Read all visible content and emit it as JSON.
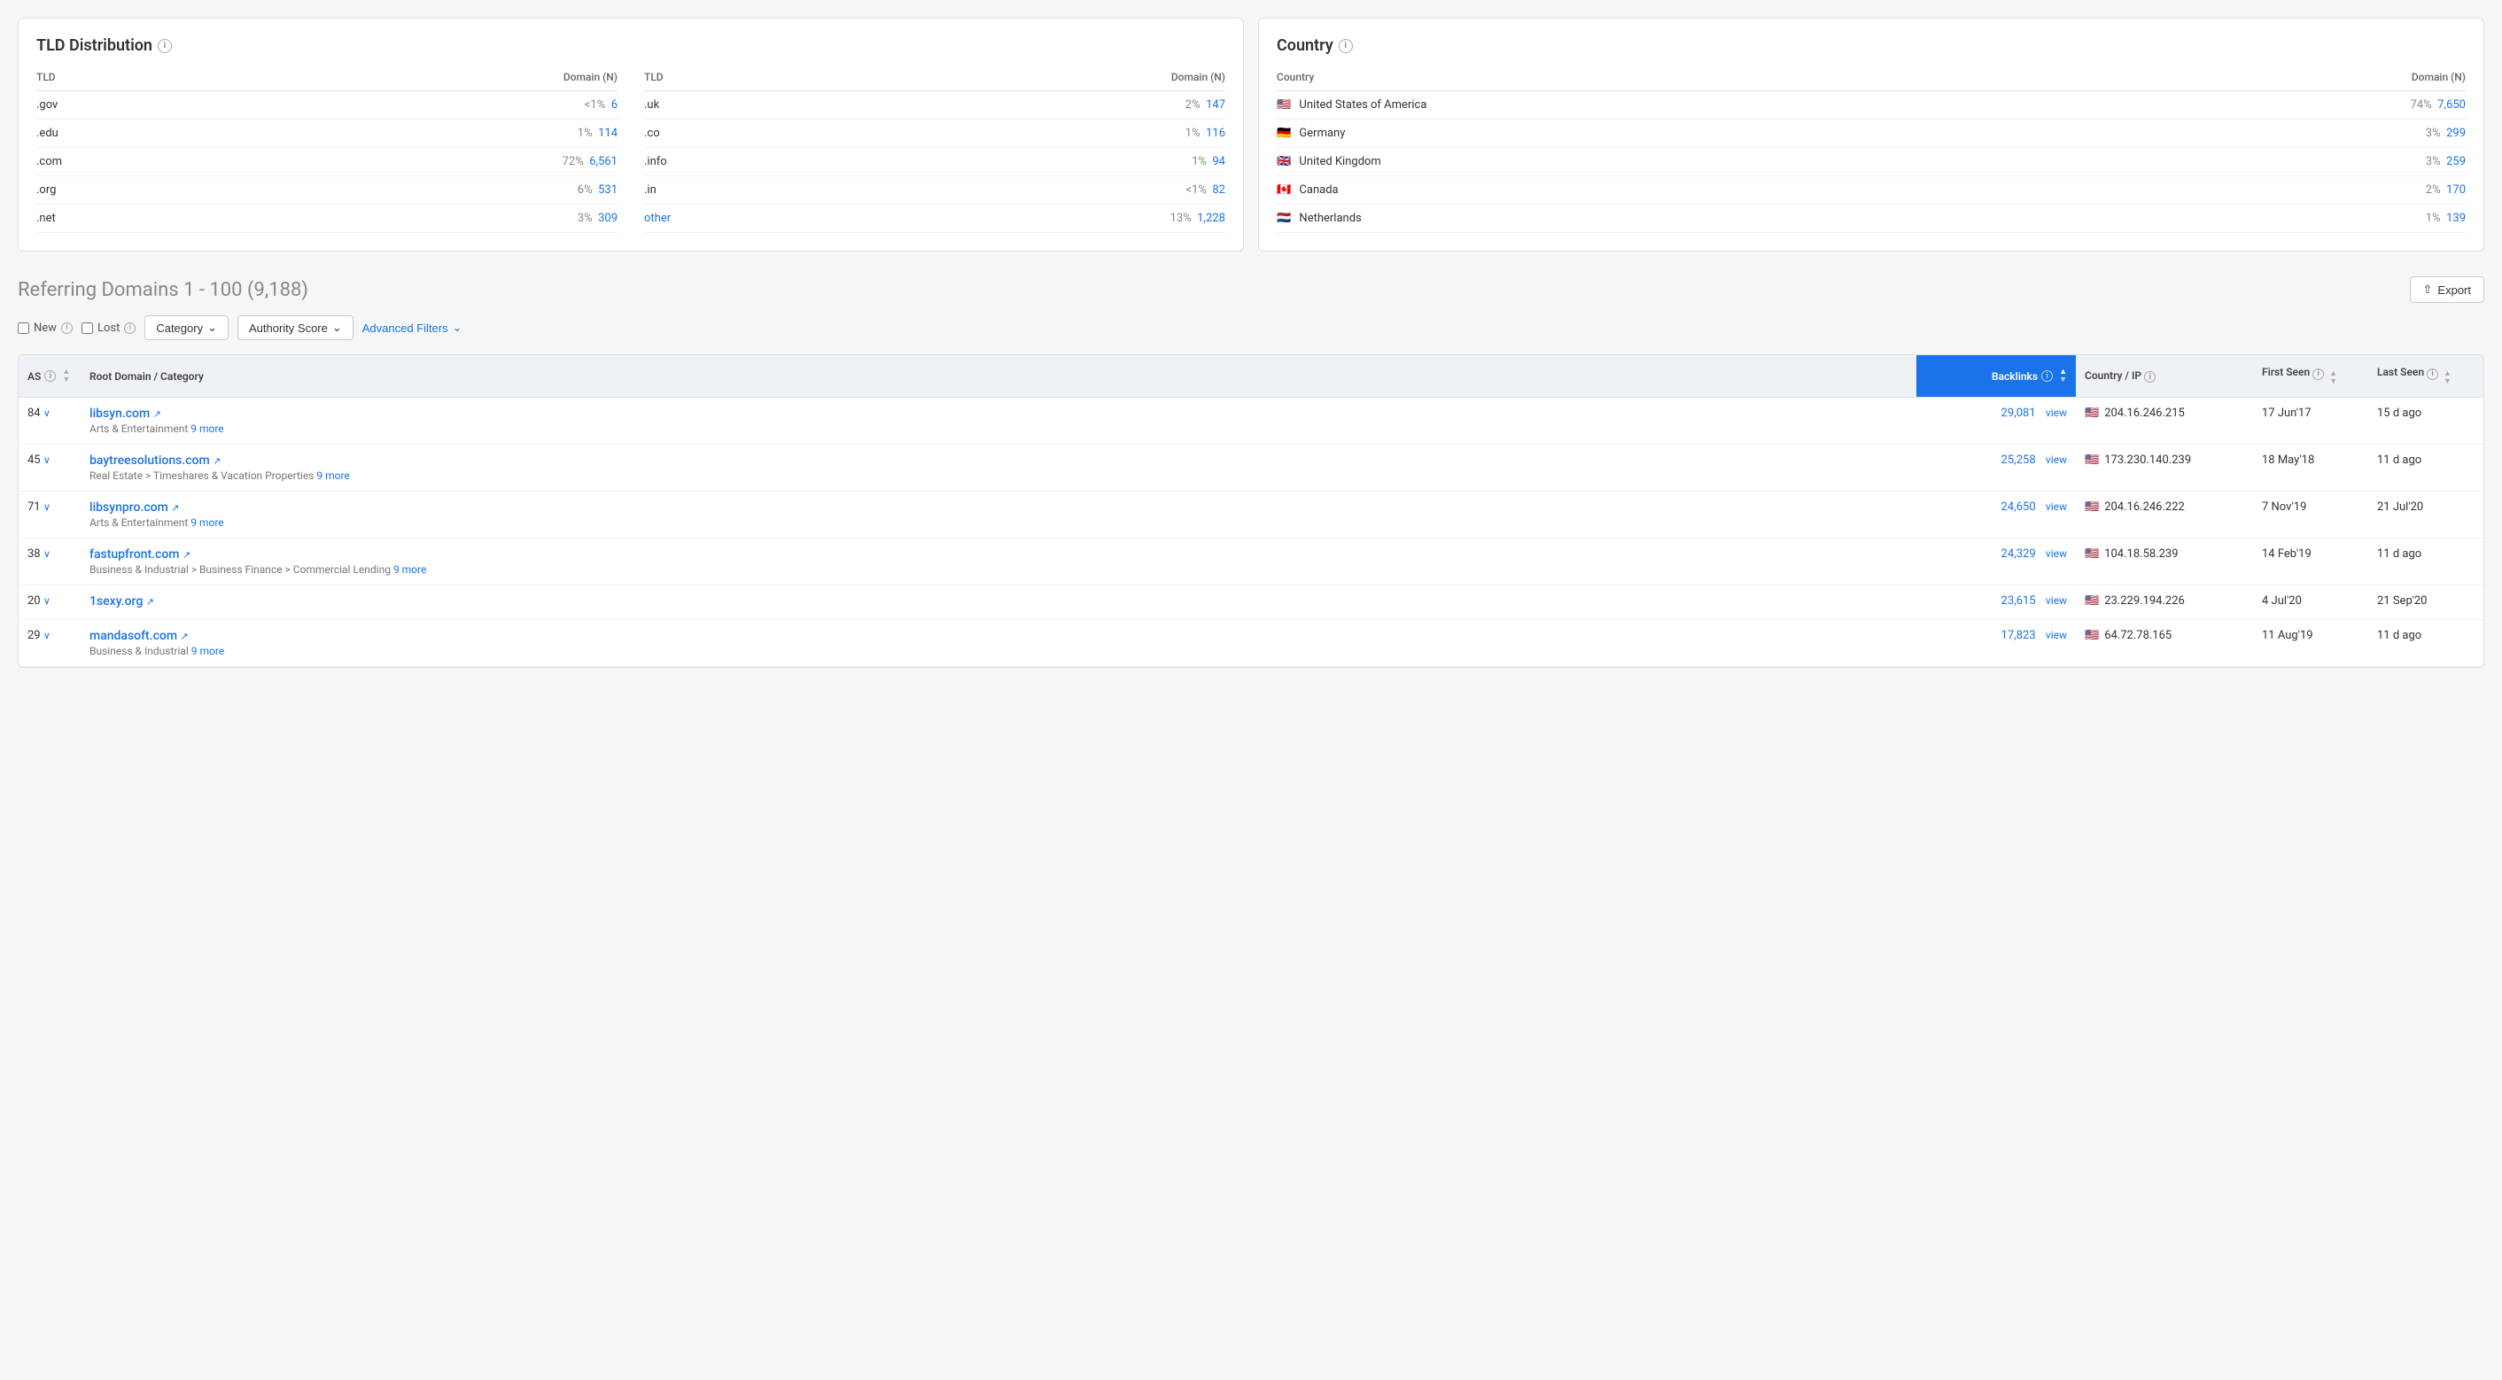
{
  "tld_card": {
    "title": "TLD Distribution",
    "col1_header_tld": "TLD",
    "col1_header_domain": "Domain (N)",
    "col2_header_tld": "TLD",
    "col2_header_domain": "Domain (N)",
    "col1_rows": [
      {
        "tld": ".gov",
        "pct": "<1%",
        "count": "6"
      },
      {
        "tld": ".edu",
        "pct": "1%",
        "count": "114"
      },
      {
        "tld": ".com",
        "pct": "72%",
        "count": "6,561"
      },
      {
        "tld": ".org",
        "pct": "6%",
        "count": "531"
      },
      {
        "tld": ".net",
        "pct": "3%",
        "count": "309"
      }
    ],
    "col2_rows": [
      {
        "tld": ".uk",
        "pct": "2%",
        "count": "147"
      },
      {
        "tld": ".co",
        "pct": "1%",
        "count": "116"
      },
      {
        "tld": ".info",
        "pct": "1%",
        "count": "94"
      },
      {
        "tld": ".in",
        "pct": "<1%",
        "count": "82"
      },
      {
        "tld": "other",
        "pct": "13%",
        "count": "1,228"
      }
    ]
  },
  "country_card": {
    "title": "Country",
    "header_country": "Country",
    "header_domain": "Domain (N)",
    "rows": [
      {
        "flag": "🇺🇸",
        "name": "United States of America",
        "pct": "74%",
        "count": "7,650"
      },
      {
        "flag": "🇩🇪",
        "name": "Germany",
        "pct": "3%",
        "count": "299"
      },
      {
        "flag": "🇬🇧",
        "name": "United Kingdom",
        "pct": "3%",
        "count": "259"
      },
      {
        "flag": "🇨🇦",
        "name": "Canada",
        "pct": "2%",
        "count": "170"
      },
      {
        "flag": "🇳🇱",
        "name": "Netherlands",
        "pct": "1%",
        "count": "139"
      }
    ]
  },
  "referring": {
    "title": "Referring Domains",
    "range": "1 - 100 (9,188)",
    "export_label": "Export",
    "filter_new": "New",
    "filter_lost": "Lost",
    "filter_category": "Category",
    "filter_authority": "Authority Score",
    "filter_advanced": "Advanced Filters",
    "table": {
      "col_as": "AS",
      "col_domain": "Root Domain / Category",
      "col_backlinks": "Backlinks",
      "col_country": "Country / IP",
      "col_first": "First Seen",
      "col_last": "Last Seen",
      "rows": [
        {
          "as": "84",
          "domain": "libsyn.com",
          "category": "Arts & Entertainment",
          "more": "9 more",
          "backlinks": "29,081",
          "flag": "🇺🇸",
          "ip": "204.16.246.215",
          "first": "17 Jun'17",
          "last": "15 d ago"
        },
        {
          "as": "45",
          "domain": "baytreesolutions.com",
          "category": "Real Estate > Timeshares & Vacation Properties",
          "more": "9 more",
          "backlinks": "25,258",
          "flag": "🇺🇸",
          "ip": "173.230.140.239",
          "first": "18 May'18",
          "last": "11 d ago"
        },
        {
          "as": "71",
          "domain": "libsynpro.com",
          "category": "Arts & Entertainment",
          "more": "9 more",
          "backlinks": "24,650",
          "flag": "🇺🇸",
          "ip": "204.16.246.222",
          "first": "7 Nov'19",
          "last": "21 Jul'20"
        },
        {
          "as": "38",
          "domain": "fastupfront.com",
          "category": "Business & Industrial > Business Finance > Commercial Lending",
          "more": "9 more",
          "backlinks": "24,329",
          "flag": "🇺🇸",
          "ip": "104.18.58.239",
          "first": "14 Feb'19",
          "last": "11 d ago"
        },
        {
          "as": "20",
          "domain": "1sexy.org",
          "category": "",
          "more": "",
          "backlinks": "23,615",
          "flag": "🇺🇸",
          "ip": "23.229.194.226",
          "first": "4 Jul'20",
          "last": "21 Sep'20"
        },
        {
          "as": "29",
          "domain": "mandasoft.com",
          "category": "Business & Industrial",
          "more": "9 more",
          "backlinks": "17,823",
          "flag": "🇺🇸",
          "ip": "64.72.78.165",
          "first": "11 Aug'19",
          "last": "11 d ago"
        }
      ]
    }
  }
}
